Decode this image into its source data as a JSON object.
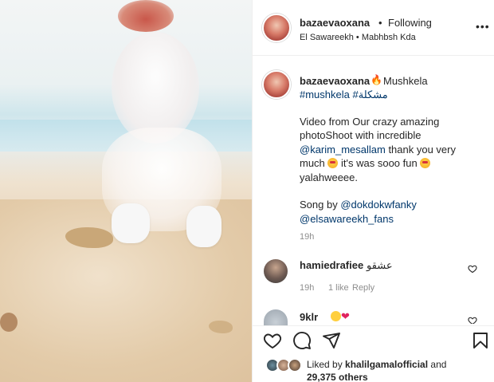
{
  "post": {
    "username": "bazaevaoxana",
    "separator": "•",
    "follow_status": "Following",
    "location": "El Sawareekh • Mabhbsh Kda",
    "more_icon": "more-options-icon"
  },
  "caption": {
    "username": "bazaevaoxana",
    "title": "Mushkela",
    "hashtags": "#mushkela #مشكلة",
    "line1": "Video from Our crazy amazing",
    "line2": "photoShoot with incredible",
    "line3_mention": "@karim_mesallam",
    "line3_text": " thank you very",
    "line4_pre": "much ",
    "line4_post": " it's was sooo fun ",
    "line5": "yalahweeee.",
    "song_pre": "Song by ",
    "song_mention1": "@dokdokwfanky",
    "song_mention2": "@elsawareekh_fans",
    "time": "19h"
  },
  "comments": [
    {
      "username": "hamiedrafiee",
      "text": "عشقو",
      "time": "19h",
      "likes": "1 like",
      "reply": "Reply"
    },
    {
      "username": "9klr",
      "text": "❤"
    }
  ],
  "actions": {
    "liked_by_prefix": "Liked by ",
    "liked_by_user": "khalilgamalofficial",
    "liked_by_mid": " and",
    "liked_by_count": "29,375 others"
  },
  "colors": {
    "link": "#00376b",
    "muted": "#8e8e8e",
    "text": "#262626",
    "border": "#efefef"
  }
}
